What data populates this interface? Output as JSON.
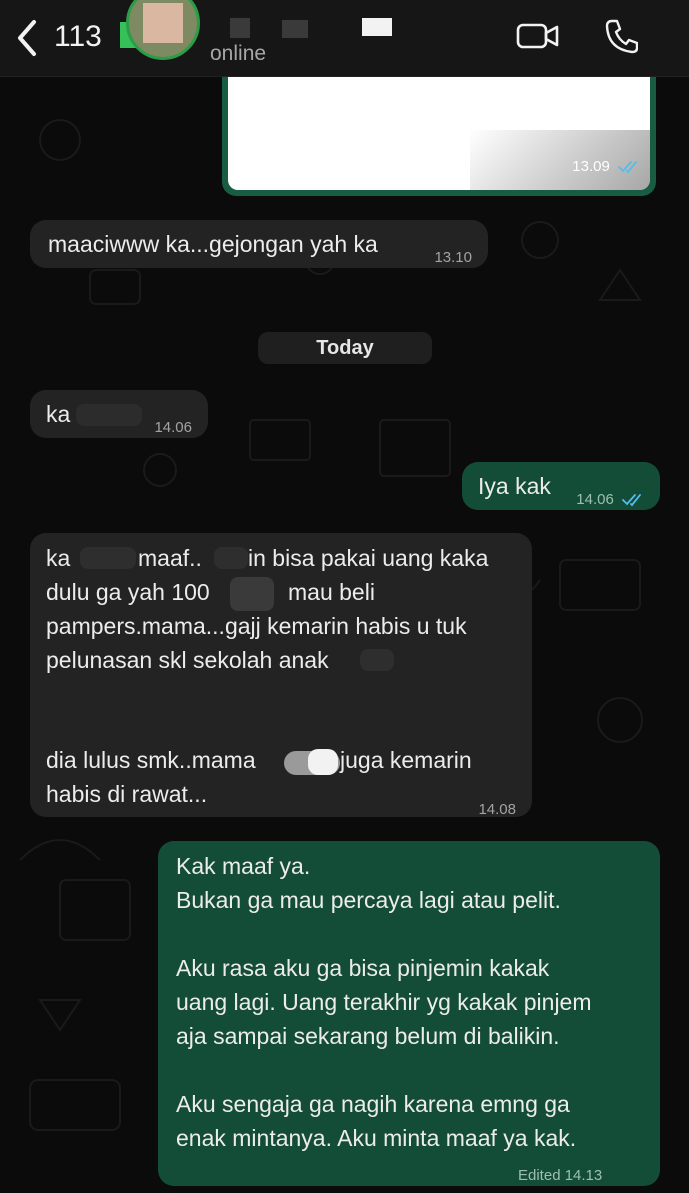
{
  "header": {
    "unread_count": "113",
    "status": "online"
  },
  "colors": {
    "incoming_bubble": "#232323",
    "outgoing_bubble": "#144d37",
    "read_ticks": "#53bdeb",
    "online_ring": "#2a9d46"
  },
  "messages": {
    "image_reply": {
      "time": "13.09"
    },
    "m1": {
      "text": "maaciwww ka...gejongan yah ka",
      "time": "13.10"
    },
    "date_separator": "Today",
    "m2": {
      "text": "ka",
      "time": "14.06"
    },
    "m3": {
      "text": "Iya kak",
      "time": "14.06"
    },
    "m4": {
      "line1a": "ka",
      "line1b": "maaf..",
      "line1c": "in bisa pakai uang kaka",
      "line2a": "dulu ga yah 100",
      "line2b": "mau beli",
      "line3": "pampers.mama...gajj kemarin habis u tuk",
      "line4": "pelunasan skl sekolah anak",
      "line5a": "dia lulus smk..mama",
      "line5b": "juga kemarin",
      "line6": "habis di rawat...",
      "time": "14.08"
    },
    "m5": {
      "p1": "Kak maaf ya.\nBukan ga mau percaya lagi atau pelit.",
      "p2": "Aku rasa aku ga bisa pinjemin kakak\nuang lagi. Uang terakhir yg kakak pinjem\naja sampai sekarang belum di balikin.",
      "p3": "Aku sengaja ga nagih karena emng ga\nenak mintanya. Aku minta maaf ya kak.",
      "meta": "Edited 14.13"
    }
  },
  "icons": [
    "chevron-left-icon",
    "video-call-icon",
    "phone-icon",
    "double-check-icon"
  ]
}
